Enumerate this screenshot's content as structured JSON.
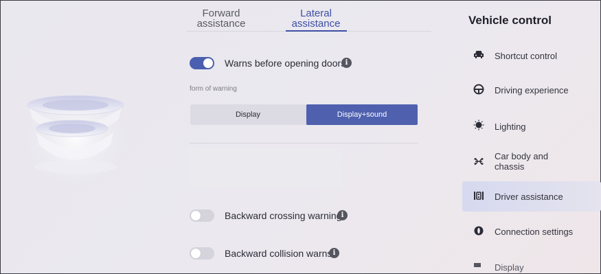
{
  "tabs": [
    {
      "label_line1": "Forward",
      "label_line2": "assistance",
      "selected": false
    },
    {
      "label_line1": "Lateral",
      "label_line2": "assistance",
      "selected": true
    }
  ],
  "settings": {
    "door_warning": {
      "label": "Warns before opening doors",
      "enabled": true,
      "info": "i"
    },
    "form_of_warning_label": "form of warning",
    "warning_options": [
      "Display",
      "Display+sound"
    ],
    "warning_selected": "Display+sound",
    "backward_crossing": {
      "label": "Backward crossing warning",
      "enabled": false,
      "info": "i"
    },
    "backward_collision": {
      "label": "Backward collision warns",
      "enabled": false,
      "info": "i"
    }
  },
  "nav": {
    "title": "Vehicle control",
    "items": [
      {
        "label": "Shortcut control",
        "icon": "car-icon"
      },
      {
        "label": "Driving experience",
        "icon": "steering-wheel-icon"
      },
      {
        "label": "Lighting",
        "icon": "light-bulb-icon"
      },
      {
        "label": "Car body and chassis",
        "label_line1": "Car body and",
        "label_line2": "chassis",
        "icon": "chassis-icon"
      },
      {
        "label": "Driver assistance",
        "icon": "driver-assistance-icon",
        "active": true
      },
      {
        "label": "Connection settings",
        "icon": "connection-icon"
      },
      {
        "label": "Display",
        "icon": "display-icon",
        "partially_visible": true
      }
    ]
  },
  "colors": {
    "accent": "#4e60ae",
    "toggle_on": "#4a5fb0",
    "toggle_off": "#d5d4dc",
    "active_nav": "#d6d9ef"
  }
}
